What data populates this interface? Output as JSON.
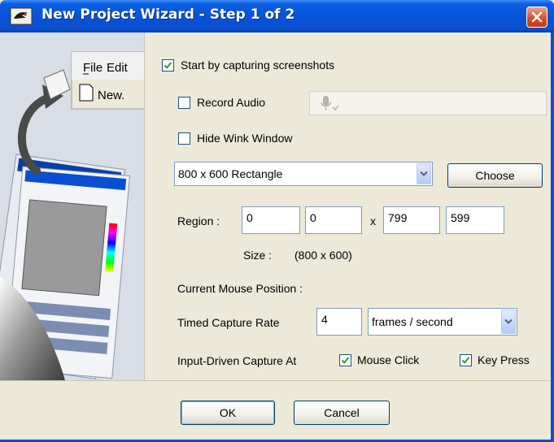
{
  "window": {
    "title": "New Project Wizard - Step 1 of 2"
  },
  "side_panel": {
    "menu_file": "File",
    "menu_edit": "Edit",
    "menu_new": "New."
  },
  "options": {
    "start_capturing": {
      "label": "Start by capturing screenshots",
      "checked": true
    },
    "record_audio": {
      "label": "Record Audio",
      "checked": false
    },
    "hide_window": {
      "label": "Hide Wink Window",
      "checked": false
    }
  },
  "capture_area": {
    "selected": "800 x 600 Rectangle",
    "choose_label": "Choose"
  },
  "region": {
    "label": "Region :",
    "x1": "0",
    "y1": "0",
    "separator": "x",
    "x2": "799",
    "y2": "599"
  },
  "size": {
    "label": "Size :",
    "value": "(800 x 600)"
  },
  "mouse_position": {
    "label": "Current Mouse Position :"
  },
  "timed_capture": {
    "label": "Timed Capture Rate",
    "value": "4",
    "unit": "frames / second"
  },
  "input_capture": {
    "label": "Input-Driven Capture At",
    "mouse_click": {
      "label": "Mouse Click",
      "checked": true
    },
    "key_press": {
      "label": "Key Press",
      "checked": true
    }
  },
  "buttons": {
    "ok": "OK",
    "cancel": "Cancel"
  },
  "colors": {
    "title_bar": "#0853d8",
    "dialog_bg": "#ECE9D8",
    "checkmark": "#21a121",
    "close_button": "#d9512a"
  },
  "icons": {
    "title": "wink-app-icon",
    "close": "close-icon",
    "microphone": "microphone-icon",
    "combo_arrow": "chevron-down-icon",
    "new_document": "document-icon"
  }
}
